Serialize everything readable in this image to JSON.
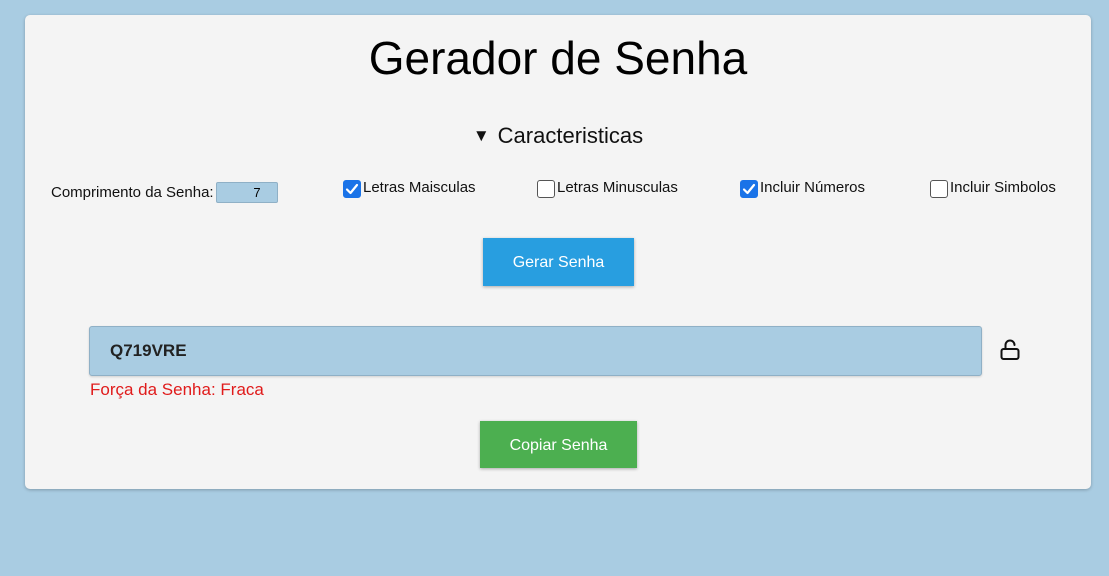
{
  "app": {
    "title": "Gerador de Senha"
  },
  "details": {
    "summary": "Caracteristicas"
  },
  "options": {
    "length_label": "Comprimento da Senha:",
    "length_value": "7",
    "uppercase": {
      "label": "Letras Maisculas",
      "checked": true
    },
    "lowercase": {
      "label": "Letras Minusculas",
      "checked": false
    },
    "numbers": {
      "label": "Incluir Números",
      "checked": true
    },
    "symbols": {
      "label": "Incluir Simbolos",
      "checked": false
    }
  },
  "actions": {
    "generate_label": "Gerar Senha",
    "copy_label": "Copiar Senha"
  },
  "result": {
    "password": "Q719VRE",
    "strength": "Força da Senha: Fraca",
    "lock_icon": "unlock-icon"
  },
  "colors": {
    "page_bg": "#a9cce2",
    "card_bg": "#f4f4f4",
    "generate_button": "#289ee0",
    "copy_button": "#4caf50",
    "strength_weak": "#e01b1b",
    "checkbox_checked": "#1a73e8"
  }
}
